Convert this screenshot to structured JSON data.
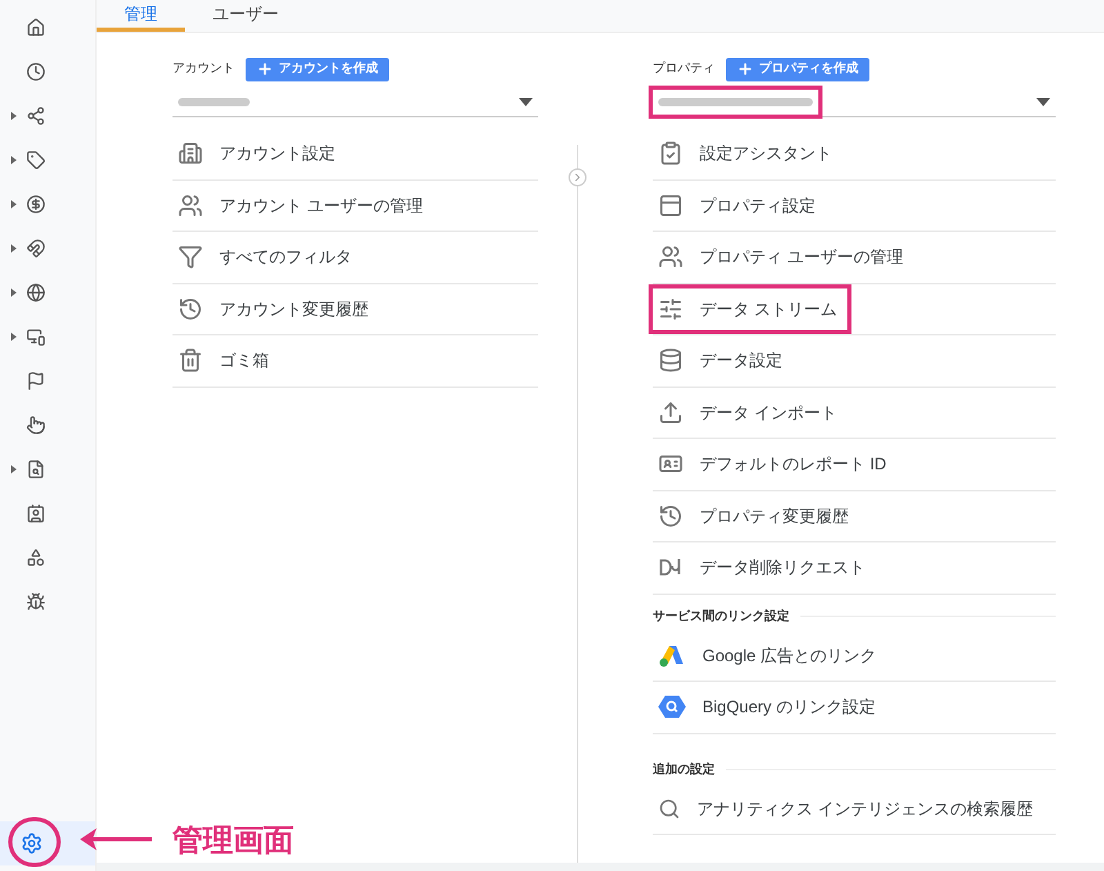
{
  "sidebar": {
    "items": [
      {
        "expandable": false,
        "selected": false
      },
      {
        "expandable": false,
        "selected": false
      },
      {
        "expandable": true,
        "selected": false
      },
      {
        "expandable": true,
        "selected": false
      },
      {
        "expandable": true,
        "selected": false
      },
      {
        "expandable": true,
        "selected": false
      },
      {
        "expandable": true,
        "selected": false
      },
      {
        "expandable": true,
        "selected": false
      },
      {
        "expandable": false,
        "selected": false
      },
      {
        "expandable": false,
        "selected": false
      },
      {
        "expandable": true,
        "selected": false
      },
      {
        "expandable": false,
        "selected": false
      },
      {
        "expandable": false,
        "selected": false
      },
      {
        "expandable": false,
        "selected": false
      }
    ],
    "settings": {
      "selected": true,
      "circled": true
    }
  },
  "tabs": [
    {
      "label": "管理",
      "selected": true
    },
    {
      "label": "ユーザー",
      "selected": false
    }
  ],
  "account": {
    "label": "アカウント",
    "create_button": "アカウントを作成",
    "select": {
      "highlighted": false
    },
    "items": [
      {
        "label": "アカウント設定"
      },
      {
        "label": "アカウント ユーザーの管理"
      },
      {
        "label": "すべてのフィルタ"
      },
      {
        "label": "アカウント変更履歴"
      },
      {
        "label": "ゴミ箱"
      }
    ]
  },
  "property": {
    "label": "プロパティ",
    "create_button": "プロパティを作成",
    "select": {
      "highlighted": true
    },
    "items": [
      {
        "label": "設定アシスタント",
        "highlighted": false
      },
      {
        "label": "プロパティ設定",
        "highlighted": false
      },
      {
        "label": "プロパティ ユーザーの管理",
        "highlighted": false
      },
      {
        "label": "データ ストリーム",
        "highlighted": true
      },
      {
        "label": "データ設定",
        "highlighted": false
      },
      {
        "label": "データ インポート",
        "highlighted": false
      },
      {
        "label": "デフォルトのレポート ID",
        "highlighted": false
      },
      {
        "label": "プロパティ変更履歴",
        "highlighted": false
      },
      {
        "label": "データ削除リクエスト",
        "highlighted": false
      }
    ],
    "sections": [
      {
        "title": "サービス間のリンク設定",
        "items": [
          {
            "label": "Google 広告とのリンク"
          },
          {
            "label": "BigQuery のリンク設定"
          }
        ]
      },
      {
        "title": "追加の設定",
        "items": [
          {
            "label": "アナリティクス インテリジェンスの検索履歴"
          }
        ]
      }
    ]
  },
  "annotation": {
    "label": "管理画面"
  }
}
